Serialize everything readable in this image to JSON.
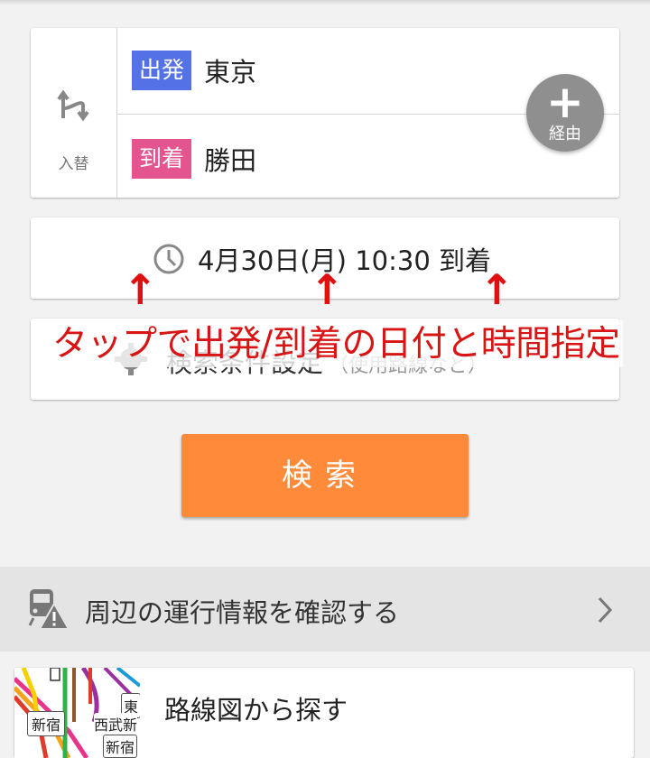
{
  "route": {
    "swap_label": "入替",
    "departure_badge": "出発",
    "departure_station": "東京",
    "arrival_badge": "到着",
    "arrival_station": "勝田",
    "via_label": "経由",
    "via_symbol": "+"
  },
  "datetime": {
    "text": "4月30日(月) 10:30 到着"
  },
  "conditions": {
    "label": "検索条件設定",
    "sublabel": "（使用路線など）"
  },
  "annotation": {
    "arrow_symbol": "↑",
    "text": "タップで出発/到着の日付と時間指定",
    "color": "#d81414"
  },
  "search_button": {
    "label": "検索",
    "color": "#ff8a3a"
  },
  "info": {
    "label": "周辺の運行情報を確認する"
  },
  "route_map": {
    "label": "路線図から探す",
    "thumb_labels": [
      "新宿",
      "東",
      "西武新",
      "新宿"
    ]
  },
  "colors": {
    "departure": "#5472e6",
    "arrival": "#e4558f",
    "via_button": "#8f8f8f"
  }
}
